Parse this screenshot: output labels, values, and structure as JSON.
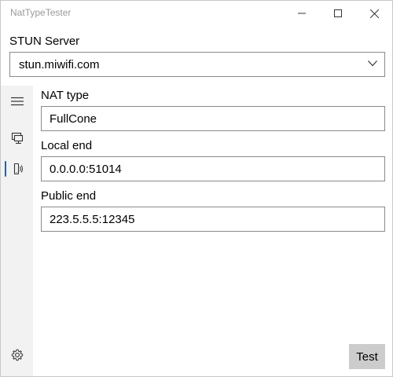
{
  "window": {
    "title": "NatTypeTester"
  },
  "stun": {
    "label": "STUN Server",
    "value": "stun.miwifi.com"
  },
  "sidebar": {
    "items": [
      {
        "icon": "hamburger-menu-icon"
      },
      {
        "icon": "monitor-icon"
      },
      {
        "icon": "network-icon",
        "selected": true
      },
      {
        "icon": "gear-icon"
      }
    ]
  },
  "fields": {
    "nat_type": {
      "label": "NAT type",
      "value": "FullCone"
    },
    "local_end": {
      "label": "Local end",
      "value": "0.0.0.0:51014"
    },
    "public_end": {
      "label": "Public end",
      "value": "223.5.5.5:12345"
    }
  },
  "actions": {
    "test_label": "Test"
  },
  "colors": {
    "accent": "#0a64c2",
    "sidebar_bg": "#f2f2f2",
    "button_bg": "#cccccc",
    "title_text": "#9a9a9a"
  }
}
